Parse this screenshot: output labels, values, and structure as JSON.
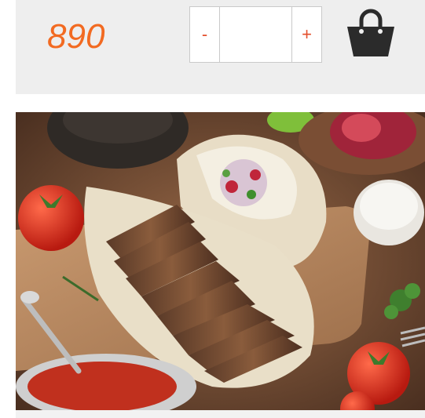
{
  "product": {
    "price": "890",
    "quantity": {
      "minus_label": "-",
      "plus_label": "+",
      "value": ""
    },
    "cart_icon": "shopping-bag-icon",
    "image_alt": "food-photo"
  },
  "colors": {
    "price": "#f26a21",
    "stepper_symbols": "#e34d2a",
    "panel_bg": "#eeeeee",
    "cart_icon": "#2b2b2b"
  }
}
